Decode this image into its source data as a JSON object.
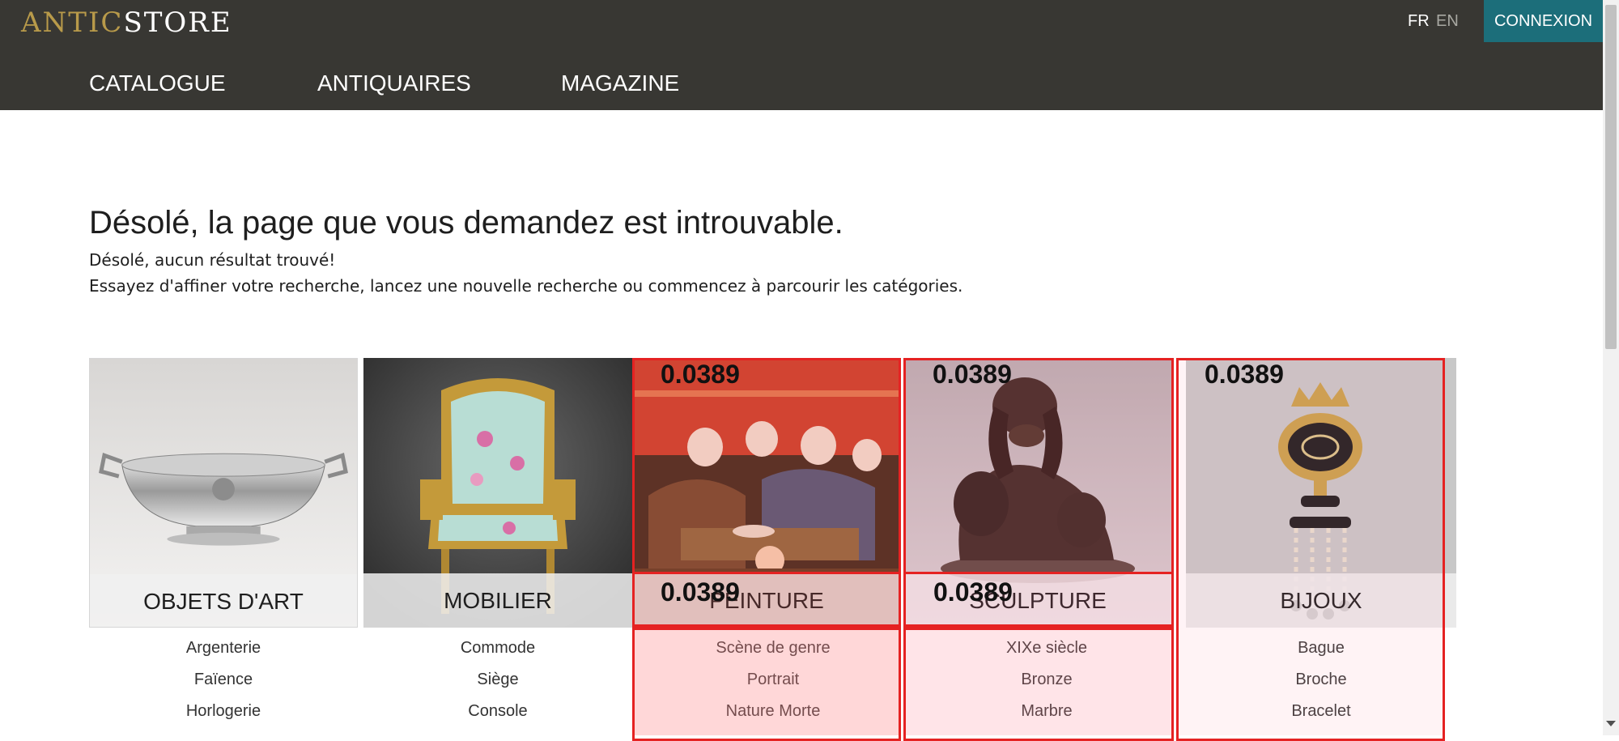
{
  "header": {
    "logo_part1": "ANTIC",
    "logo_part2": "STORE",
    "lang_fr": "FR",
    "lang_en": "EN",
    "login_label": "CONNEXION",
    "nav": [
      "CATALOGUE",
      "ANTIQUAIRES",
      "MAGAZINE"
    ]
  },
  "main": {
    "title": "Désolé, la page que vous demandez est introuvable.",
    "line1": "Désolé, aucun résultat trouvé!",
    "line2": "Essayez d'affiner votre recherche, lancez une nouvelle recherche ou commencez à parcourir les catégories."
  },
  "categories": [
    {
      "name": "OBJETS D'ART",
      "items": [
        "Argenterie",
        "Faïence",
        "Horlogerie"
      ]
    },
    {
      "name": "MOBILIER",
      "items": [
        "Commode",
        "Siège",
        "Console"
      ]
    },
    {
      "name": "PEINTURE",
      "items": [
        "Scène de genre",
        "Portrait",
        "Nature Morte"
      ]
    },
    {
      "name": "SCULPTURE",
      "items": [
        "XIXe siècle",
        "Bronze",
        "Marbre"
      ]
    },
    {
      "name": "BIJOUX",
      "items": [
        "Bague",
        "Broche",
        "Bracelet"
      ]
    }
  ],
  "overlay": {
    "color": "#e52222",
    "scores": [
      "0.0389",
      "0.0389",
      "0.0389",
      "0.0389",
      "0.0389"
    ]
  },
  "colors": {
    "header_bg": "#383733",
    "accent_gold": "#b89a4a",
    "login_bg": "#1c6e7a"
  }
}
